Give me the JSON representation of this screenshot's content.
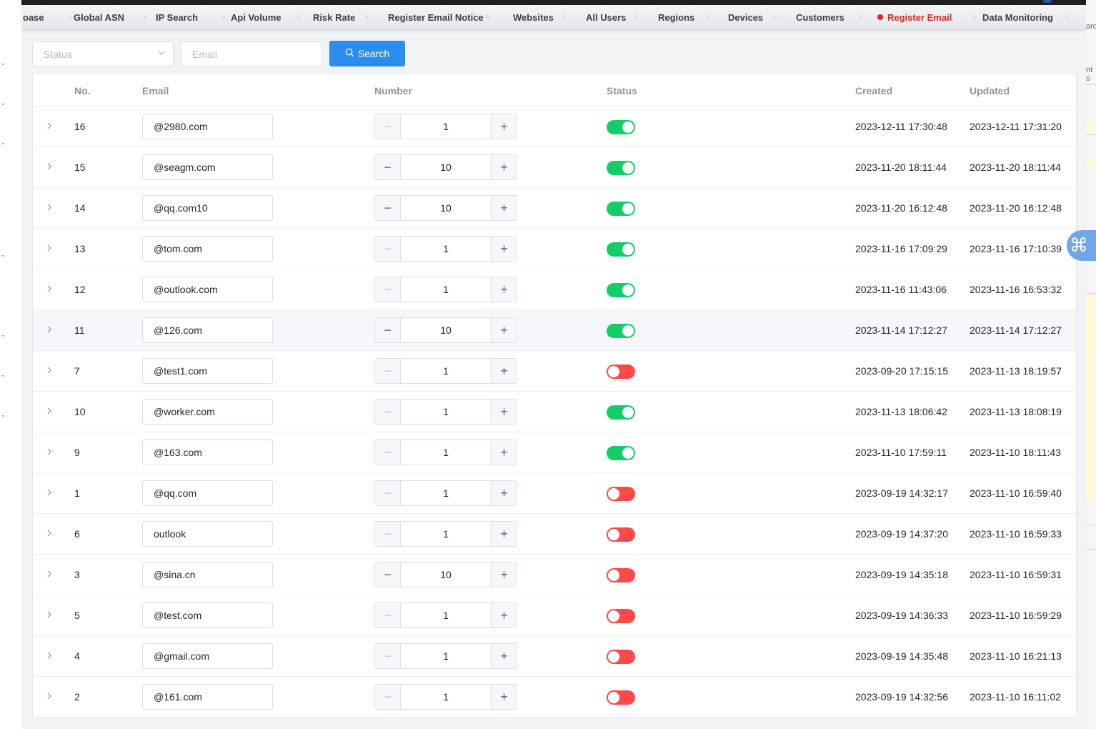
{
  "tabs": [
    {
      "label": "oase",
      "x": 0
    },
    {
      "label": "Global ASN"
    },
    {
      "label": "IP Search"
    },
    {
      "label": "Api Volume"
    },
    {
      "label": "Risk Rate"
    },
    {
      "label": "Register Email Notice"
    },
    {
      "label": "Websites"
    },
    {
      "label": "All Users"
    },
    {
      "label": "Regions"
    },
    {
      "label": "Devices"
    },
    {
      "label": "Customers"
    },
    {
      "label": "Register Email",
      "active": true
    },
    {
      "label": "Data Monitoring"
    }
  ],
  "search": {
    "status_placeholder": "Status",
    "email_placeholder": "Email",
    "button_label": "Search"
  },
  "table": {
    "headers": {
      "no": "No.",
      "email": "Email",
      "number": "Number",
      "status": "Status",
      "created": "Created",
      "updated": "Updated"
    },
    "rows": [
      {
        "no": "16",
        "email": "@2980.com",
        "number": "1",
        "status": true,
        "created": "2023-12-11 17:30:48",
        "updated": "2023-12-11 17:31:20"
      },
      {
        "no": "15",
        "email": "@seagm.com",
        "number": "10",
        "status": true,
        "created": "2023-11-20 18:11:44",
        "updated": "2023-11-20 18:11:44"
      },
      {
        "no": "14",
        "email": "@qq.com10",
        "number": "10",
        "status": true,
        "created": "2023-11-20 16:12:48",
        "updated": "2023-11-20 16:12:48"
      },
      {
        "no": "13",
        "email": "@tom.com",
        "number": "1",
        "status": true,
        "created": "2023-11-16 17:09:29",
        "updated": "2023-11-16 17:10:39"
      },
      {
        "no": "12",
        "email": "@outlook.com",
        "number": "1",
        "status": true,
        "created": "2023-11-16 11:43:06",
        "updated": "2023-11-16 16:53:32"
      },
      {
        "no": "11",
        "email": "@126.com",
        "number": "10",
        "status": true,
        "created": "2023-11-14 17:12:27",
        "updated": "2023-11-14 17:12:27"
      },
      {
        "no": "7",
        "email": "@test1.com",
        "number": "1",
        "status": false,
        "created": "2023-09-20 17:15:15",
        "updated": "2023-11-13 18:19:57"
      },
      {
        "no": "10",
        "email": "@worker.com",
        "number": "1",
        "status": true,
        "created": "2023-11-13 18:06:42",
        "updated": "2023-11-13 18:08:19"
      },
      {
        "no": "9",
        "email": "@163.com",
        "number": "1",
        "status": true,
        "created": "2023-11-10 17:59:11",
        "updated": "2023-11-10 18:11:43"
      },
      {
        "no": "1",
        "email": "@qq.com",
        "number": "1",
        "status": false,
        "created": "2023-09-19 14:32:17",
        "updated": "2023-11-10 16:59:40"
      },
      {
        "no": "6",
        "email": "outlook",
        "number": "1",
        "status": false,
        "created": "2023-09-19 14:37:20",
        "updated": "2023-11-10 16:59:33"
      },
      {
        "no": "3",
        "email": "@sina.cn",
        "number": "10",
        "status": false,
        "created": "2023-09-19 14:35:18",
        "updated": "2023-11-10 16:59:31"
      },
      {
        "no": "5",
        "email": "@test.com",
        "number": "1",
        "status": false,
        "created": "2023-09-19 14:36:33",
        "updated": "2023-11-10 16:59:29"
      },
      {
        "no": "4",
        "email": "@gmail.com",
        "number": "1",
        "status": false,
        "created": "2023-09-19 14:35:48",
        "updated": "2023-11-10 16:21:13"
      },
      {
        "no": "2",
        "email": "@161.com",
        "number": "1",
        "status": false,
        "created": "2023-09-19 14:32:56",
        "updated": "2023-11-10 16:11:02"
      }
    ]
  },
  "right_edge": {
    "text_top": "ard",
    "text_mid": "nt s"
  },
  "colors": {
    "accent": "#2d8cf0",
    "active_tab": "#e62222",
    "switch_on": "#13ce66",
    "switch_off": "#ff4949"
  },
  "icons": {
    "expand": "chevron-right-icon",
    "search": "search-icon",
    "select_arrow": "chevron-down-icon",
    "floating": "command-icon"
  }
}
